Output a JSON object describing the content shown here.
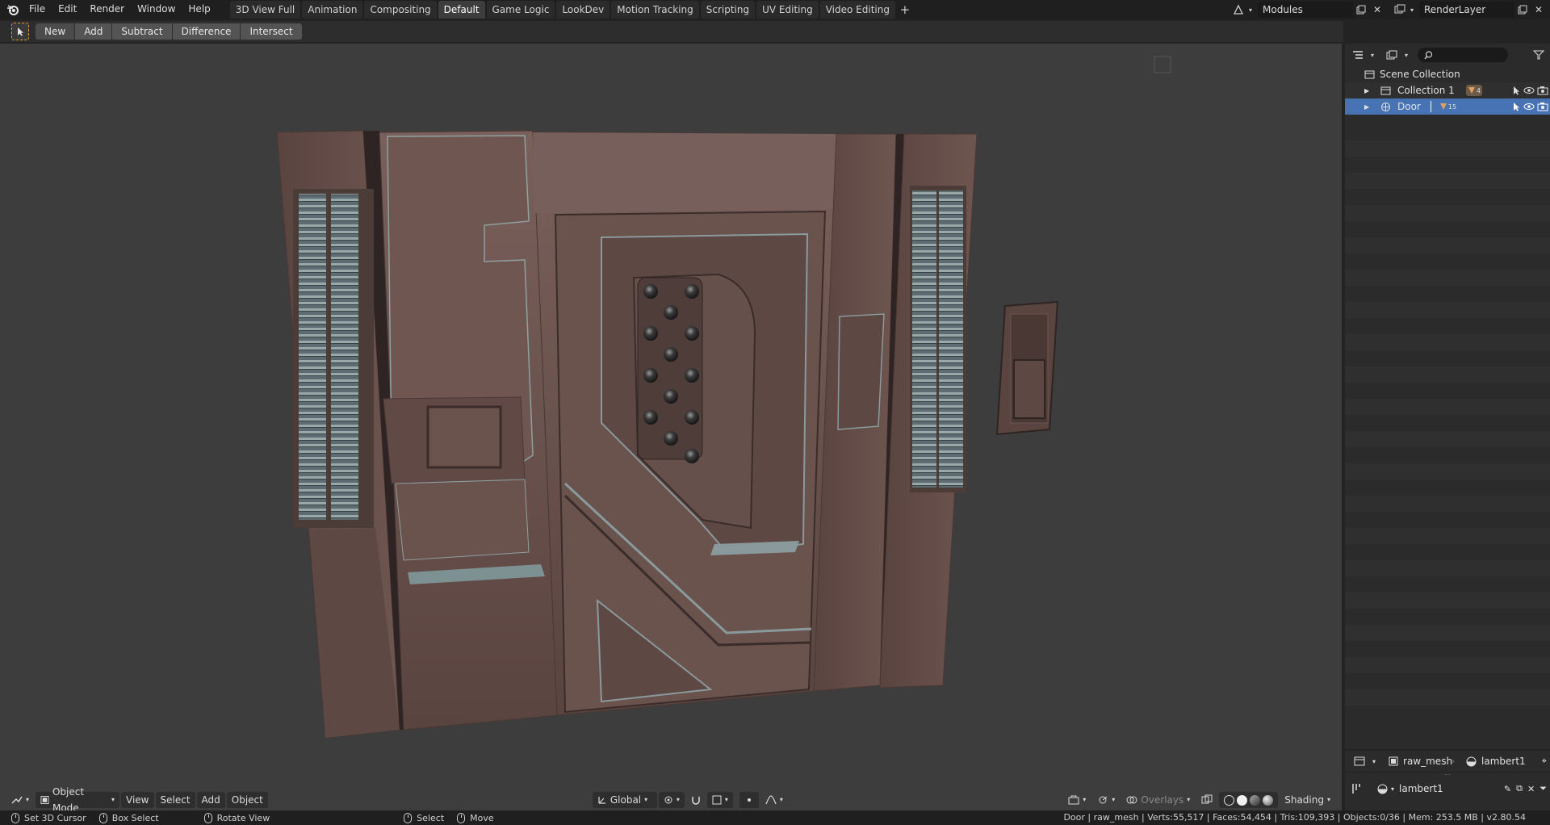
{
  "menu": {
    "items": [
      "File",
      "Edit",
      "Render",
      "Window",
      "Help"
    ]
  },
  "workspaces": {
    "tabs": [
      "3D View Full",
      "Animation",
      "Compositing",
      "Default",
      "Game Logic",
      "LookDev",
      "Motion Tracking",
      "Scripting",
      "UV Editing",
      "Video Editing"
    ],
    "active": "Default",
    "add_label": "+"
  },
  "topright": {
    "scene": "Modules",
    "view_layer": "RenderLayer"
  },
  "toolheader": {
    "boolean_ops": [
      "New",
      "Add",
      "Subtract",
      "Difference",
      "Intersect"
    ]
  },
  "viewport_header": {
    "mode": "Object Mode",
    "menus": [
      "View",
      "Select",
      "Add",
      "Object"
    ],
    "orientation": "Global",
    "overlays": "Overlays",
    "shading": "Shading"
  },
  "statusbar": {
    "left": [
      "Set 3D Cursor",
      "Box Select",
      "Rotate View"
    ],
    "middle": [
      "Select",
      "Move"
    ],
    "stats": "Door | raw_mesh | Verts:55,517 | Faces:54,454 | Tris:109,393 | Objects:0/36 | Mem: 253.5 MB | v2.80.54"
  },
  "outliner": {
    "root": "Scene Collection",
    "rows": [
      {
        "label": "Collection 1",
        "badge": "4",
        "selected": false
      },
      {
        "label": "Door",
        "badge": "15",
        "selected": true
      }
    ]
  },
  "properties": {
    "object_data": "raw_mesh",
    "material": "lambert1",
    "material_slot": "lambert1"
  },
  "colors": {
    "accent": "#4772b3",
    "viewport_bg": "#3d3d3d",
    "door": "#6b5450"
  }
}
